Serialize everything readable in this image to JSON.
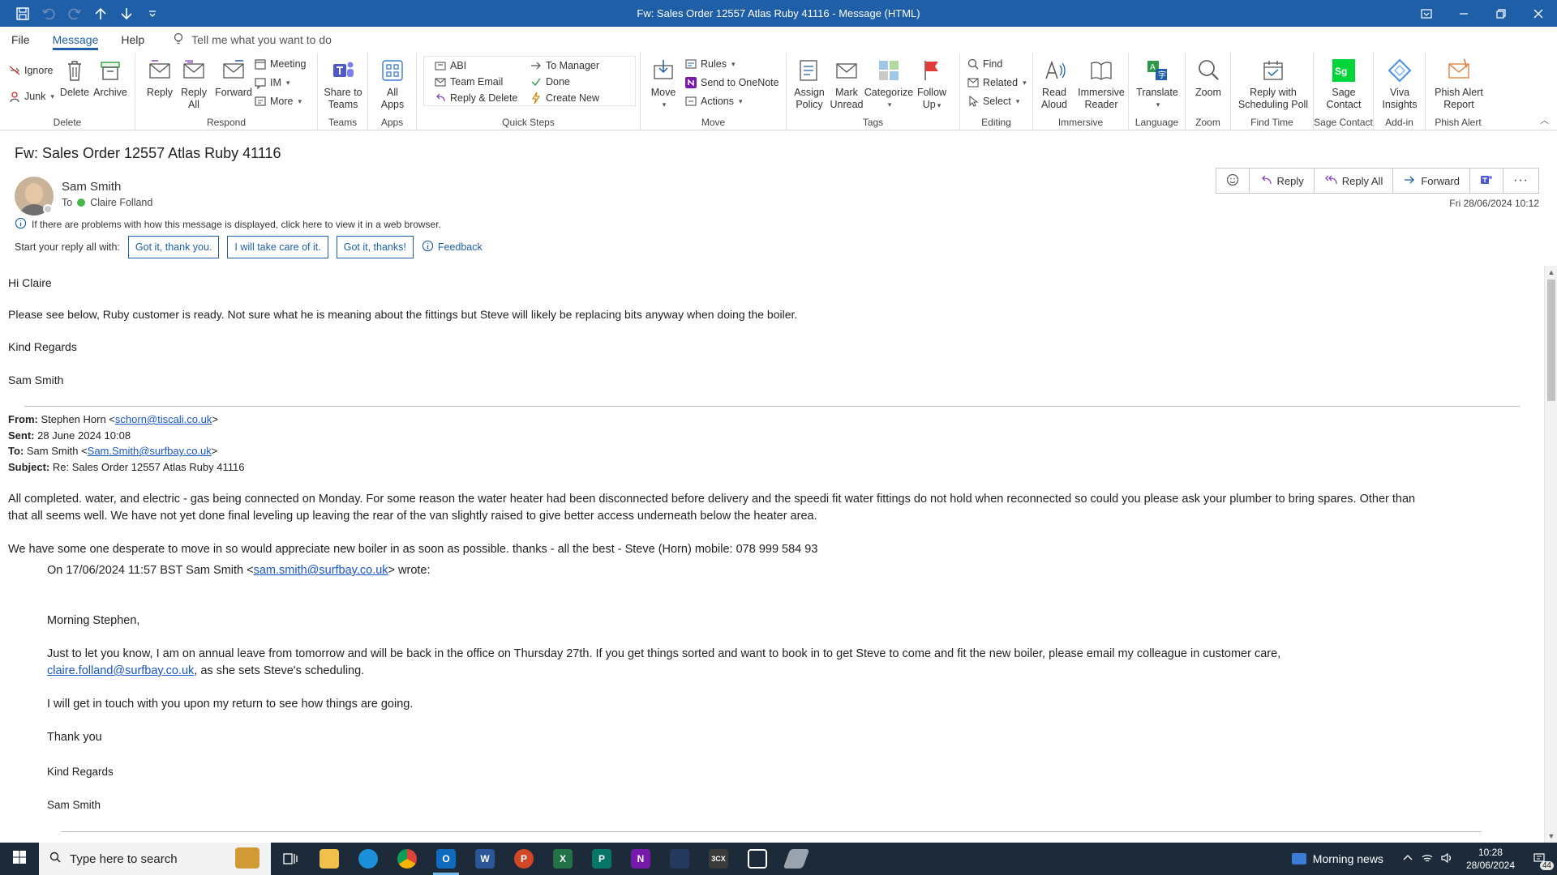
{
  "window": {
    "title": "Fw: Sales Order 12557 Atlas Ruby 41116  -  Message (HTML)"
  },
  "menu": {
    "tabs": [
      "File",
      "Message",
      "Help"
    ],
    "active_tab": "Message",
    "tell_me": "Tell me what you want to do"
  },
  "ribbon": {
    "delete_group": {
      "label": "Delete",
      "ignore": "Ignore",
      "junk": "Junk",
      "delete": "Delete",
      "archive": "Archive"
    },
    "respond_group": {
      "label": "Respond",
      "reply": "Reply",
      "reply_all_1": "Reply",
      "reply_all_2": "All",
      "forward": "Forward",
      "meeting": "Meeting",
      "im": "IM",
      "more": "More"
    },
    "teams_group": {
      "label": "Teams",
      "share_1": "Share to",
      "share_2": "Teams"
    },
    "apps_group": {
      "label": "Apps",
      "all_1": "All",
      "all_2": "Apps"
    },
    "quicksteps_group": {
      "label": "Quick Steps",
      "items": [
        "ABI",
        "To Manager",
        "Team Email",
        "Done",
        "Reply & Delete",
        "Create New"
      ]
    },
    "move_group": {
      "label": "Move",
      "move": "Move",
      "rules": "Rules",
      "onenote": "Send to OneNote",
      "actions": "Actions"
    },
    "tags_group": {
      "label": "Tags",
      "assign_1": "Assign",
      "assign_2": "Policy",
      "mark_1": "Mark",
      "mark_2": "Unread",
      "categorize": "Categorize",
      "follow_1": "Follow",
      "follow_2": "Up"
    },
    "editing_group": {
      "label": "Editing",
      "find": "Find",
      "related": "Related",
      "select": "Select"
    },
    "immersive_group": {
      "label": "Immersive",
      "read_1": "Read",
      "read_2": "Aloud",
      "imm_1": "Immersive",
      "imm_2": "Reader"
    },
    "language_group": {
      "label": "Language",
      "translate": "Translate"
    },
    "zoom_group": {
      "label": "Zoom",
      "zoom": "Zoom"
    },
    "findtime_group": {
      "label": "Find Time",
      "reply_1": "Reply with",
      "reply_2": "Scheduling Poll"
    },
    "sage_group": {
      "label": "Sage Contact",
      "sage_1": "Sage",
      "sage_2": "Contact"
    },
    "addin_group": {
      "label": "Add-in",
      "viva_1": "Viva",
      "viva_2": "Insights"
    },
    "phish_group": {
      "label": "Phish Alert",
      "phish_1": "Phish Alert",
      "phish_2": "Report"
    }
  },
  "message": {
    "subject": "Fw: Sales Order 12557 Atlas Ruby 41116",
    "sender": "Sam Smith",
    "to_label": "To",
    "recipient": "Claire Folland",
    "info_notice": "If there are problems with how this message is displayed, click here to view it in a web browser.",
    "quick_reply_prompt": "Start your reply all with:",
    "quick_replies": [
      "Got it, thank you.",
      "I will take care of it.",
      "Got it, thanks!"
    ],
    "feedback": "Feedback",
    "actions": {
      "reply": "Reply",
      "reply_all": "Reply All",
      "forward": "Forward"
    },
    "date": "Fri 28/06/2024 10:12"
  },
  "body": {
    "greeting": "Hi Claire",
    "para1": "Please see below, Ruby customer is ready. Not sure what he is meaning about the fittings but Steve will likely be replacing bits anyway when doing the boiler.",
    "regards": "Kind Regards",
    "signature": "Sam Smith",
    "fwd": {
      "from_label": "From:",
      "from_name": "Stephen Horn <",
      "from_email": "schorn@tiscali.co.uk",
      "from_close": ">",
      "sent_label": "Sent:",
      "sent": "28 June 2024 10:08",
      "to_label": "To:",
      "to_name": "Sam Smith <",
      "to_email": "Sam.Smith@surfbay.co.uk",
      "to_close": ">",
      "subject_label": "Subject:",
      "subject": "Re: Sales Order 12557 Atlas Ruby 41116"
    },
    "reply_para1_line1": "All completed.   water, and electric - gas being connected on Monday. For some reason the water heater had been disconnected before delivery and the speedi fit water fittings do not hold when reconnected so could you please ask your plumber to bring spares.  Other than",
    "reply_para1_line2": "that all seems well.  We have not yet done final leveling up leaving the rear of the van slightly raised to give better access underneath below the heater area.",
    "reply_para2": "We have some one desperate to move in so would appreciate new boiler in as soon as possible.    thanks  -  all the best - Steve (Horn)     mobile:  078 999 584 93",
    "quoted": {
      "on_prefix": "On 17/06/2024 11:57 BST Sam Smith <",
      "on_email": "sam.smith@surfbay.co.uk",
      "on_suffix": "> wrote:",
      "greeting": "Morning Stephen,",
      "para_line1": "Just to let you know, I am on annual leave from tomorrow and will be back in the office on Thursday 27th. If you get things sorted and want to book in to get Steve to come and fit the new boiler, please email my colleague in customer care,",
      "para_email": "claire.folland@surfbay.co.uk",
      "para_line2_suffix": ", as she sets Steve's scheduling.",
      "para2": "I will get in touch with you upon my return to see how things are going.",
      "thanks": "Thank you",
      "regards": "Kind Regards",
      "signature": "Sam Smith"
    }
  },
  "taskbar": {
    "search_placeholder": "Type here to search",
    "news": "Morning news",
    "time": "10:28",
    "date": "28/06/2024",
    "notifications": "44"
  }
}
